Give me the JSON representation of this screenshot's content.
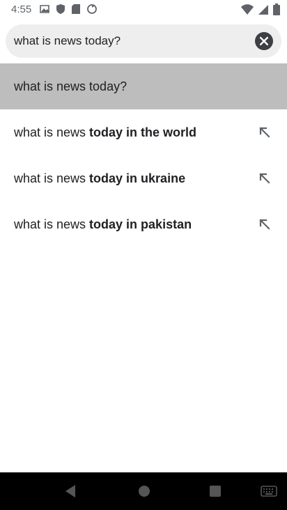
{
  "status": {
    "time": "4:55",
    "left_icons": [
      "photos-icon",
      "shield-icon",
      "sd-card-icon",
      "sync-icon"
    ],
    "right_icons": [
      "wifi-icon",
      "signal-icon",
      "battery-icon"
    ]
  },
  "search": {
    "value": "what is news today?"
  },
  "suggestions": [
    {
      "plain": "what is news today?",
      "bold": "",
      "highlighted": true,
      "has_arrow": false
    },
    {
      "plain": "what is news ",
      "bold": "today in the world",
      "highlighted": false,
      "has_arrow": true
    },
    {
      "plain": "what is news ",
      "bold": "today in ukraine",
      "highlighted": false,
      "has_arrow": true
    },
    {
      "plain": "what is news ",
      "bold": "today in pakistan",
      "highlighted": false,
      "has_arrow": true
    }
  ],
  "nav": {
    "buttons": [
      "back",
      "home",
      "recents",
      "keyboard"
    ]
  },
  "colors": {
    "highlight": "#bdbdbd",
    "search_bg": "#eeeeee",
    "nav_bg": "#000000"
  }
}
